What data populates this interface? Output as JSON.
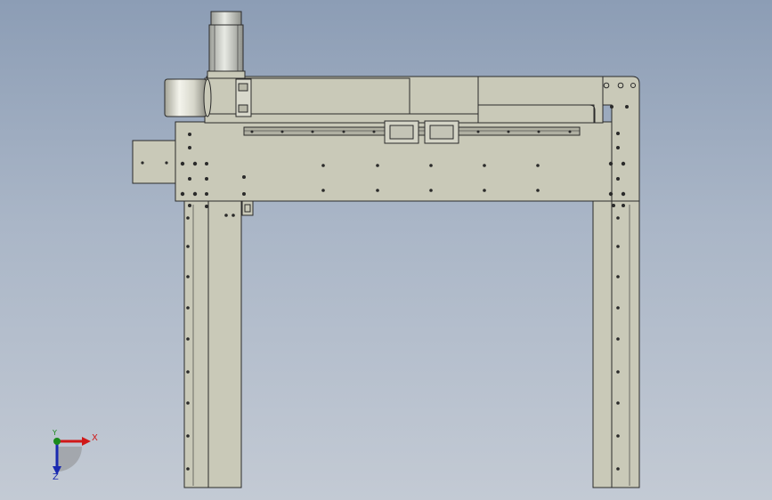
{
  "viewport": {
    "background_top": "#8c9db5",
    "background_bottom": "#c3cad4",
    "part_face_color": "#c9c9b8",
    "edge_color": "#2a2a2a",
    "rail_color": "#9c9c8e",
    "motor_color": "#c4c6c0"
  },
  "triad": {
    "x_label": "X",
    "y_label": "Y",
    "z_label": "Z",
    "x_color": "#d01818",
    "y_color": "#1a8a1a",
    "z_color": "#1a2ab0",
    "icon": "coordinate-triad-icon"
  }
}
